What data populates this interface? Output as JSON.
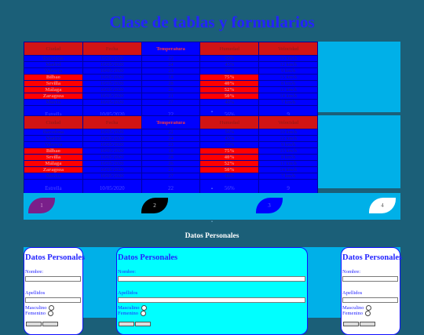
{
  "header": {
    "title": "Clase de tablas y formularios"
  },
  "tables": [
    {
      "headers": [
        "Ciudad",
        "Fecha",
        "Temperatura",
        "Humedad",
        "Velocidad"
      ],
      "rows": [
        [
          "Barcelona",
          "10/05/2020",
          "22",
          "56%",
          "10 km/h"
        ],
        [
          "Madrid",
          "10/05/2020",
          "24",
          "45%",
          "12 km/h"
        ],
        [
          "Valencia",
          "10/05/2020",
          "23",
          "60%",
          "9 km/h"
        ],
        [
          "Bilbao",
          "10/05/2020",
          "18",
          "75%",
          "15 km/h"
        ],
        [
          "Sevilla",
          "10/05/2020",
          "28",
          "40%",
          "8 km/h"
        ],
        [
          "Málaga",
          "10/05/2020",
          "26",
          "52%",
          "11 km/h"
        ],
        [
          "Zaragoza",
          "10/05/2020",
          "21",
          "50%",
          "14 km/h"
        ],
        [
          "Murcia",
          "10/05/2020",
          "27",
          "48%",
          "7 km/h"
        ]
      ],
      "footer": [
        "Estrella",
        "10/05/2020",
        "22",
        "56%",
        "9"
      ]
    },
    {
      "headers": [
        "Ciudad",
        "Fecha",
        "Temperatura",
        "Humedad",
        "Velocidad"
      ],
      "rows": [
        [
          "Barcelona",
          "10/05/2020",
          "22",
          "56%",
          "10 km/h"
        ],
        [
          "Madrid",
          "10/05/2020",
          "24",
          "45%",
          "12 km/h"
        ],
        [
          "Valencia",
          "10/05/2020",
          "23",
          "60%",
          "9 km/h"
        ],
        [
          "Bilbao",
          "10/05/2020",
          "18",
          "75%",
          "15 km/h"
        ],
        [
          "Sevilla",
          "10/05/2020",
          "28",
          "40%",
          "8 km/h"
        ],
        [
          "Málaga",
          "10/05/2020",
          "26",
          "52%",
          "11 km/h"
        ],
        [
          "Zaragoza",
          "10/05/2020",
          "21",
          "50%",
          "14 km/h"
        ],
        [
          "Murcia",
          "10/05/2020",
          "27",
          "48%",
          "7 km/h"
        ]
      ],
      "footer": [
        "Estrella",
        "10/05/2020",
        "22",
        "56%",
        "9"
      ]
    }
  ],
  "shapes": [
    "1",
    "2",
    "3",
    "4"
  ],
  "forms_section": {
    "title": "Datos Personales",
    "forms": [
      {
        "heading": "Datos Personales",
        "name_label": "Nombre:",
        "surname_label": "Apellidos",
        "male": "Masculino",
        "female": "Femenino"
      },
      {
        "heading": "Datos Personales",
        "name_label": "Nombre:",
        "surname_label": "Apellidos",
        "male": "Masculino",
        "female": "Femenino"
      },
      {
        "heading": "Datos Personales",
        "name_label": "Nombre:",
        "surname_label": "Apellidos",
        "male": "Masculino",
        "female": "Femenino"
      }
    ]
  },
  "colors": {
    "background": "#1b5f78",
    "band": "#00b0e8",
    "table_cell": "#0000ff",
    "header_red": "#d11414",
    "title": "#2323ff"
  }
}
